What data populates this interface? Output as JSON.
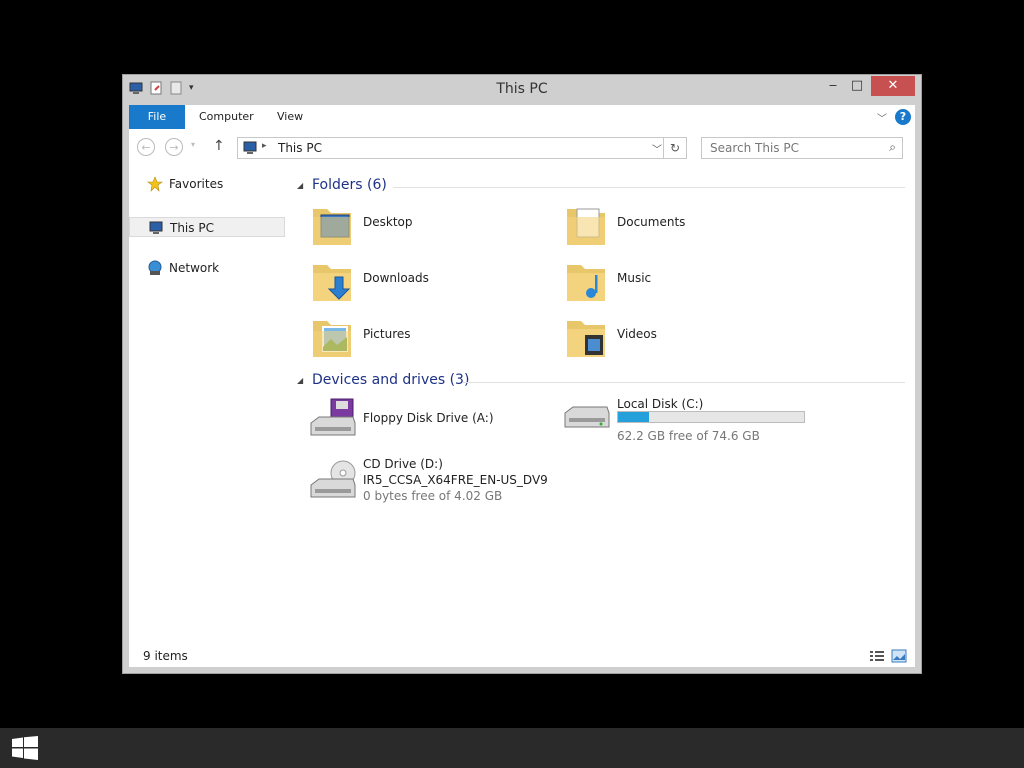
{
  "window": {
    "title": "This PC"
  },
  "window_controls": {
    "minimize": "‒",
    "maximize": "□",
    "close": "✕"
  },
  "ribbon": {
    "tabs": [
      {
        "label": "File"
      },
      {
        "label": "Computer"
      },
      {
        "label": "View"
      }
    ],
    "help": "?",
    "accent_color": "#1979ca"
  },
  "address_bar": {
    "location": "This PC",
    "search_placeholder": "Search This PC"
  },
  "nav_pane": {
    "items": [
      {
        "label": "Favorites",
        "icon": "star-icon"
      },
      {
        "label": "This PC",
        "icon": "computer-icon",
        "selected": true
      },
      {
        "label": "Network",
        "icon": "network-icon"
      }
    ]
  },
  "groups": {
    "folders": {
      "header": "Folders (6)",
      "items": [
        {
          "label": "Desktop",
          "icon": "desktop-folder-icon"
        },
        {
          "label": "Documents",
          "icon": "documents-folder-icon"
        },
        {
          "label": "Downloads",
          "icon": "downloads-folder-icon"
        },
        {
          "label": "Music",
          "icon": "music-folder-icon"
        },
        {
          "label": "Pictures",
          "icon": "pictures-folder-icon"
        },
        {
          "label": "Videos",
          "icon": "videos-folder-icon"
        }
      ]
    },
    "drives": {
      "header": "Devices and drives (3)",
      "items": [
        {
          "label": "Floppy Disk Drive (A:)",
          "icon": "floppy-drive-icon"
        },
        {
          "label": "Local Disk (C:)",
          "icon": "hard-disk-icon",
          "free_text": "62.2 GB free of 74.6 GB",
          "used_fraction": 0.166
        },
        {
          "label": "CD Drive (D:)",
          "volume": "IR5_CCSA_X64FRE_EN-US_DV9",
          "icon": "cd-drive-icon",
          "free_text": "0 bytes free of 4.02 GB"
        }
      ]
    }
  },
  "status_bar": {
    "item_count": "9 items"
  },
  "colors": {
    "usage_bar": "#26a0da",
    "group_header": "#1e3287",
    "close_button": "#c75050"
  }
}
